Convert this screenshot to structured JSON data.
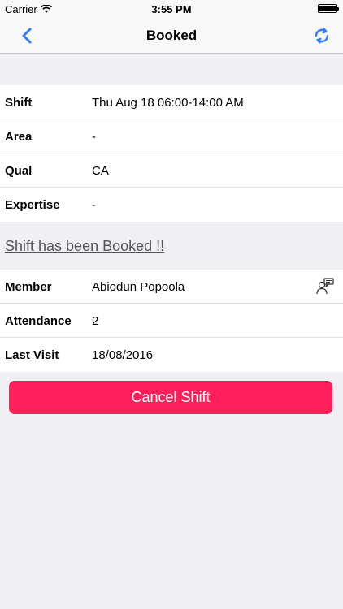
{
  "status_bar": {
    "carrier": "Carrier",
    "time": "3:55 PM"
  },
  "nav": {
    "title": "Booked"
  },
  "shift": {
    "rows": [
      {
        "label": "Shift",
        "value": "Thu Aug 18 06:00-14:00 AM"
      },
      {
        "label": "Area",
        "value": "-"
      },
      {
        "label": "Qual",
        "value": "CA"
      },
      {
        "label": "Expertise",
        "value": "-"
      }
    ]
  },
  "message": "Shift has been Booked !!",
  "member": {
    "rows": [
      {
        "label": "Member",
        "value": "Abiodun   Popoola"
      },
      {
        "label": "Attendance",
        "value": "2"
      },
      {
        "label": "Last Visit",
        "value": "18/08/2016"
      }
    ]
  },
  "cancel_button": {
    "label": "Cancel Shift"
  },
  "colors": {
    "accent": "#2f7cf6",
    "cancel": "#ff1f5a",
    "background": "#efeff4"
  }
}
